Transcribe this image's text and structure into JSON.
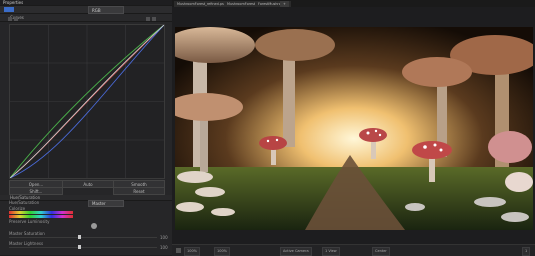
{
  "left_panel": {
    "header_title": "Properties",
    "dropdown_value": "RGB",
    "curves_section": "Curves",
    "curve_buttons": {
      "row1": [
        "Open...",
        "Auto",
        "Smooth"
      ],
      "row2": [
        "Shift...",
        "Reset"
      ]
    },
    "hue_section": "Hue/Saturation",
    "hue_rows": [
      {
        "label": "Hue/Saturation",
        "value": "Master"
      },
      {
        "label": "Colorize",
        "value": "Master"
      },
      {
        "label": "Preserve Luminosity",
        "value": ""
      }
    ],
    "sliders": [
      {
        "label": "Master Saturation",
        "value": "100"
      },
      {
        "label": "Master Lightness",
        "value": "100"
      }
    ]
  },
  "tabs": [
    "MushroomForest_refined.psd",
    "MushroomForest",
    "ForestMushrooms",
    "+"
  ],
  "bottom_bar": {
    "zoom": "100%",
    "items": [
      "100%",
      "Active Camera",
      "1 View",
      "Center"
    ],
    "frame": "1"
  },
  "colors": {
    "panel_bg": "#262628",
    "accent": "#4a7fd8",
    "mushroom_cap": "#b94848",
    "mushroom_cap_light": "#c9a98a"
  }
}
